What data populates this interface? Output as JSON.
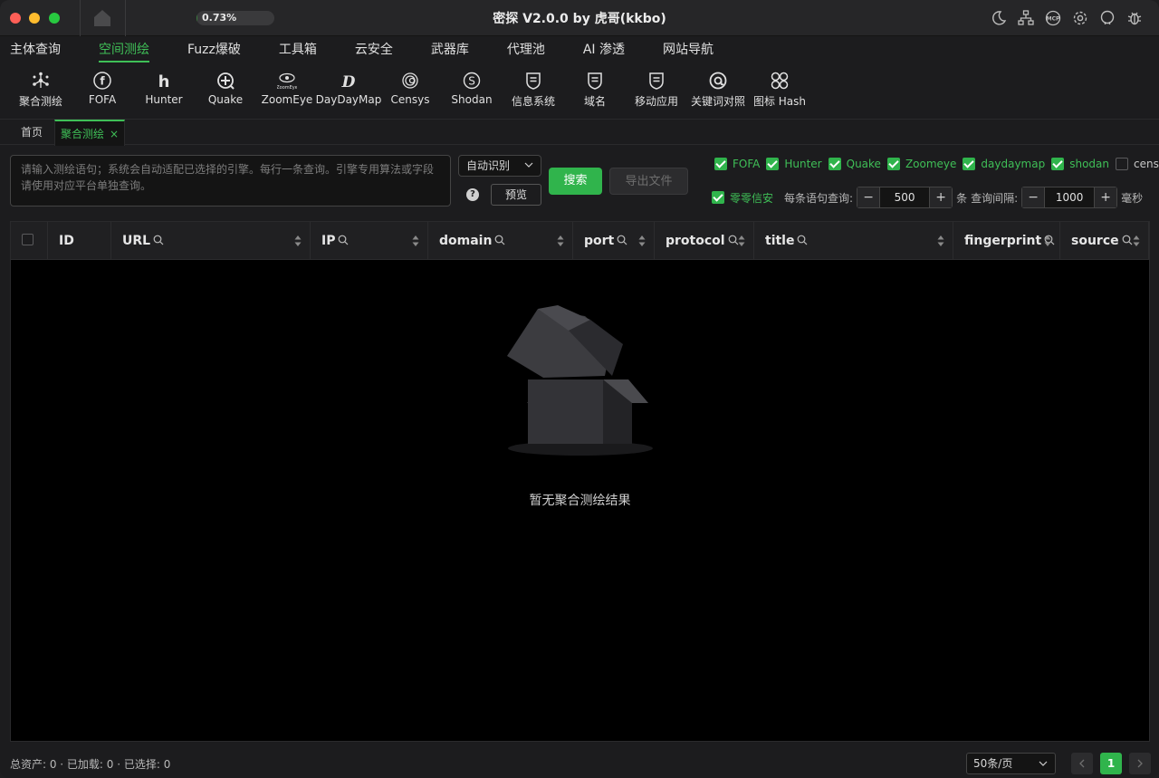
{
  "window": {
    "title": "密探 V2.0.0 by 虎哥(kkbo)",
    "progress_text": "0.73%",
    "progress_value": 0.0073
  },
  "titlebar_icons": [
    "moon-icon",
    "network-icon",
    "mcp-icon",
    "gear-icon",
    "github-icon",
    "bug-icon"
  ],
  "menu": {
    "items": [
      "主体查询",
      "空间测绘",
      "Fuzz爆破",
      "工具箱",
      "云安全",
      "武器库",
      "代理池",
      "AI 渗透",
      "网站导航"
    ],
    "active_index": 1
  },
  "toolbar": {
    "items": [
      {
        "label": "聚合测绘",
        "icon": "aggregate-icon"
      },
      {
        "label": "FOFA",
        "icon": "fofa-icon"
      },
      {
        "label": "Hunter",
        "icon": "hunter-icon"
      },
      {
        "label": "Quake",
        "icon": "quake-icon"
      },
      {
        "label": "ZoomEye",
        "icon": "zoomeye-icon",
        "icon_text": "ZoomEye"
      },
      {
        "label": "DayDayMap",
        "icon": "daydaymap-icon"
      },
      {
        "label": "Censys",
        "icon": "censys-icon"
      },
      {
        "label": "Shodan",
        "icon": "shodan-icon"
      },
      {
        "label": "信息系统",
        "icon": "info-system-icon"
      },
      {
        "label": "域名",
        "icon": "domain-icon"
      },
      {
        "label": "移动应用",
        "icon": "mobile-app-icon"
      },
      {
        "label": "关键词对照",
        "icon": "keyword-icon"
      },
      {
        "label": "图标 Hash",
        "icon": "icon-hash-icon"
      }
    ]
  },
  "tabs": {
    "home": "首页",
    "active": "聚合测绘",
    "close": "×"
  },
  "search": {
    "placeholder": "请输入测绘语句；系统会自动适配已选择的引擎。每行一条查询。引擎专用算法或字段请使用对应平台单独查询。",
    "mode": "自动识别",
    "help": "?",
    "preview": "预览",
    "search_button": "搜索",
    "export_button": "导出文件"
  },
  "engines": [
    {
      "label": "FOFA",
      "checked": true
    },
    {
      "label": "Hunter",
      "checked": true
    },
    {
      "label": "Quake",
      "checked": true
    },
    {
      "label": "Zoomeye",
      "checked": true
    },
    {
      "label": "daydaymap",
      "checked": true
    },
    {
      "label": "shodan",
      "checked": true
    },
    {
      "label": "censys",
      "checked": false
    }
  ],
  "options": {
    "lingling_label": "零零信安",
    "lingling_checked": true,
    "per_query_label": "每条语句查询:",
    "per_query_value": "500",
    "per_query_unit": "条",
    "interval_label": "查询间隔:",
    "interval_value": "1000",
    "interval_unit": "毫秒",
    "minus": "−",
    "plus": "+"
  },
  "table": {
    "columns": [
      "ID",
      "URL",
      "IP",
      "domain",
      "port",
      "protocol",
      "title",
      "fingerprint",
      "source"
    ],
    "empty_text": "暂无聚合测绘结果"
  },
  "footer": {
    "stats": "总资产: 0 · 已加载: 0 · 已选择: 0",
    "page_size": "50条/页",
    "current_page": "1"
  }
}
